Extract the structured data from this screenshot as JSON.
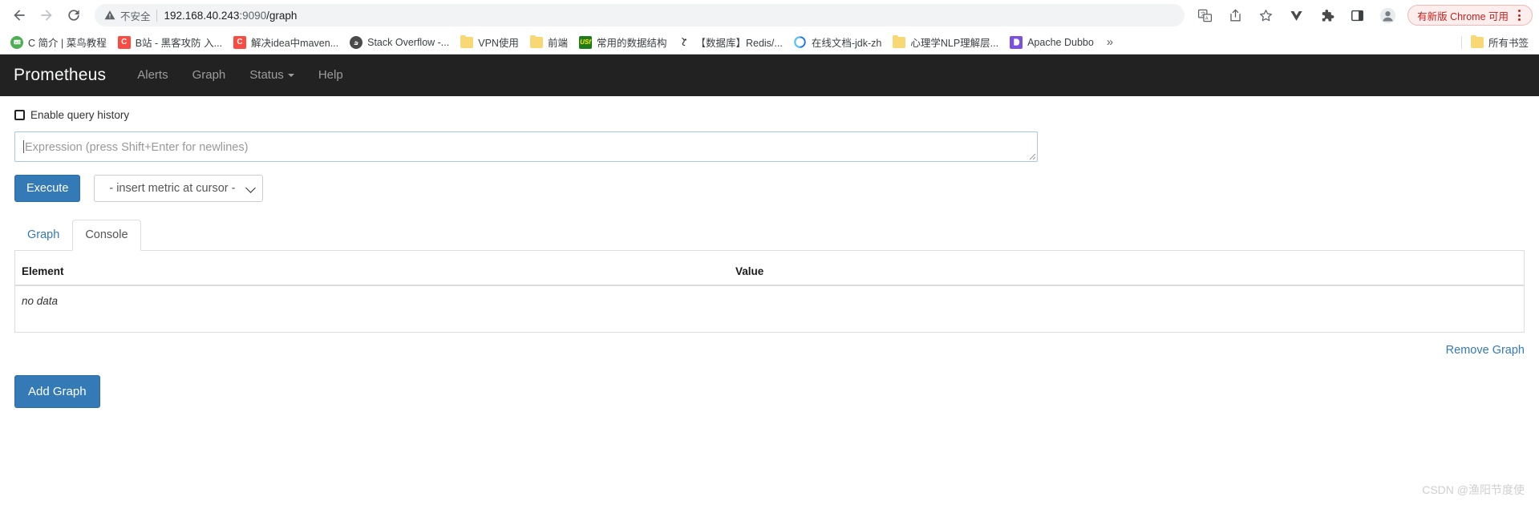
{
  "browser": {
    "nav": {
      "back_title": "Back",
      "forward_title": "Forward",
      "reload_title": "Reload"
    },
    "omnibox": {
      "security_label": "不安全",
      "url_host": "192.168.40.243",
      "url_port": ":9090",
      "url_path": "/graph",
      "full_url": "192.168.40.243:9090/graph"
    },
    "toolbar_icons": [
      {
        "name": "translate-icon",
        "title": "翻译"
      },
      {
        "name": "share-icon",
        "title": "分享"
      },
      {
        "name": "bookmark-star-icon",
        "title": "收藏"
      },
      {
        "name": "vue-devtools-icon",
        "title": "Vue Devtools"
      },
      {
        "name": "extensions-puzzle-icon",
        "title": "扩展程序"
      },
      {
        "name": "side-panel-icon",
        "title": "side panel"
      },
      {
        "name": "profile-avatar-icon",
        "title": "个人资料"
      }
    ],
    "update_pill": {
      "label": "有新版 Chrome 可用",
      "color": "#c5221f",
      "bg": "#fdeeee",
      "border": "#f2b8b5"
    },
    "bookmarks": [
      {
        "label": "C 简介 | 菜鸟教程",
        "icon": "site-favicon",
        "fav_bg": "#4caf50",
        "fav_text": ""
      },
      {
        "label": "B站 - 黑客攻防 入...",
        "icon": "site-favicon",
        "fav_bg": "#fb4a41",
        "fav_text": "C"
      },
      {
        "label": "解决idea中maven...",
        "icon": "site-favicon",
        "fav_bg": "#fb4a41",
        "fav_text": "C"
      },
      {
        "label": "Stack Overflow -...",
        "icon": "site-favicon",
        "fav_bg": "#4a4a4a",
        "fav_text": "S"
      },
      {
        "label": "VPN使用",
        "icon": "folder-icon",
        "fav_bg": "",
        "fav_text": ""
      },
      {
        "label": "前端",
        "icon": "folder-icon",
        "fav_bg": "",
        "fav_text": ""
      },
      {
        "label": "常用的数据结构",
        "icon": "site-favicon",
        "fav_bg": "#1d7d1d",
        "fav_text": "USf"
      },
      {
        "label": "【数据库】Redis/...",
        "icon": "site-favicon",
        "fav_bg": "#ffffff",
        "fav_text": ""
      },
      {
        "label": "在线文档-jdk-zh",
        "icon": "site-favicon",
        "fav_bg": "#1a73e8",
        "fav_text": "e"
      },
      {
        "label": "心理学NLP理解层...",
        "icon": "folder-icon",
        "fav_bg": "",
        "fav_text": ""
      },
      {
        "label": "Apache Dubbo",
        "icon": "site-favicon",
        "fav_bg": "#7b4fe0",
        "fav_text": "D"
      }
    ],
    "bookmarks_overflow_label": "»",
    "all_bookmarks_label": "所有书签"
  },
  "prometheus": {
    "brand": "Prometheus",
    "nav_items": [
      {
        "label": "Alerts",
        "has_caret": false
      },
      {
        "label": "Graph",
        "has_caret": false
      },
      {
        "label": "Status",
        "has_caret": true
      },
      {
        "label": "Help",
        "has_caret": false
      }
    ],
    "query_history": {
      "label": "Enable query history",
      "checked": false
    },
    "expression": {
      "value": "",
      "placeholder": "Expression (press Shift+Enter for newlines)"
    },
    "execute_button": "Execute",
    "metric_select": {
      "selected": "- insert metric at cursor -",
      "options": [
        "- insert metric at cursor -"
      ]
    },
    "tabs": [
      {
        "label": "Graph",
        "active": false
      },
      {
        "label": "Console",
        "active": true
      }
    ],
    "table": {
      "headers": [
        "Element",
        "Value"
      ],
      "rows": [],
      "empty_text": "no data"
    },
    "remove_graph_label": "Remove Graph",
    "add_graph_label": "Add Graph",
    "colors": {
      "navbar_bg": "#222222",
      "primary": "#337ab7",
      "link": "#337ab7"
    }
  },
  "watermark": "CSDN @渔阳节度使"
}
